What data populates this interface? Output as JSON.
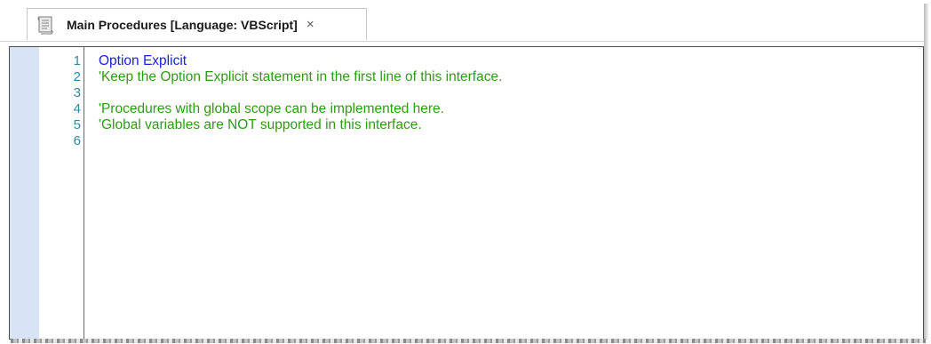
{
  "tab": {
    "title": "Main Procedures [Language: VBScript]",
    "close_glyph": "×",
    "icon": "script-document-icon"
  },
  "editor": {
    "lines": [
      {
        "number": "1",
        "text": "Option Explicit",
        "kind": "keyword"
      },
      {
        "number": "2",
        "text": "'Keep the Option Explicit statement in the first line of this interface.",
        "kind": "comment"
      },
      {
        "number": "3",
        "text": "",
        "kind": "blank"
      },
      {
        "number": "4",
        "text": "'Procedures with global scope can be implemented here.",
        "kind": "comment"
      },
      {
        "number": "5",
        "text": "'Global variables are NOT supported in this interface.",
        "kind": "comment"
      },
      {
        "number": "6",
        "text": "",
        "kind": "blank"
      }
    ]
  },
  "colors": {
    "keyword": "#1c22e0",
    "comment": "#2e9c13",
    "line_number": "#2f86a8",
    "margin": "#d6e4f5"
  }
}
